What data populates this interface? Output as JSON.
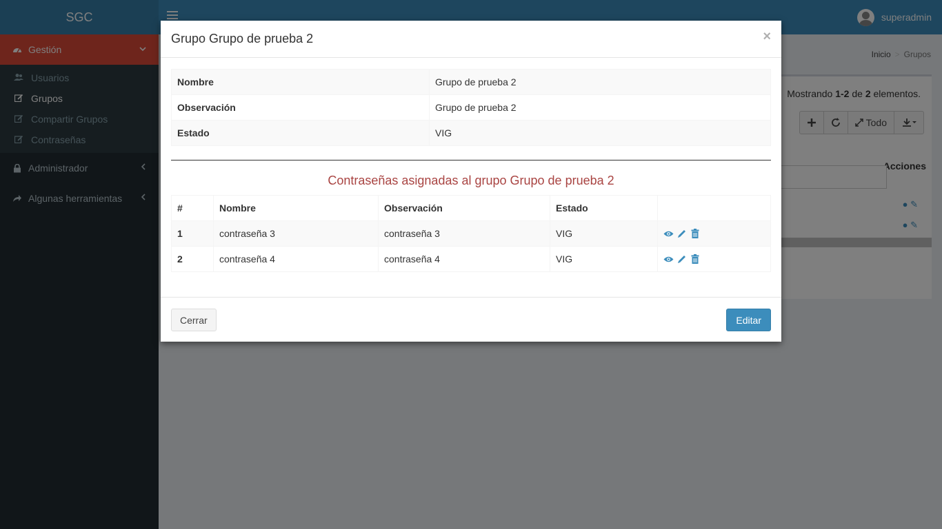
{
  "app": {
    "logo": "SGC",
    "user_name": "superadmin"
  },
  "sidebar": {
    "main": {
      "label": "Gestión"
    },
    "sub_items": [
      {
        "label": "Usuarios"
      },
      {
        "label": "Grupos"
      },
      {
        "label": "Compartir Grupos"
      },
      {
        "label": "Contraseñas"
      }
    ],
    "items": [
      {
        "label": "Administrador"
      },
      {
        "label": "Algunas herramientas"
      }
    ]
  },
  "breadcrumb": {
    "home": "Inicio",
    "current": "Grupos"
  },
  "list": {
    "summary_prefix": "Mostrando",
    "summary_range": "1-2",
    "summary_mid": "de",
    "summary_total": "2",
    "summary_suffix": "elementos.",
    "toolbar_all_label": "Todo",
    "actions_header": "Acciones"
  },
  "modal": {
    "title": "Grupo Grupo de prueba 2",
    "close_symbol": "×",
    "details": [
      {
        "label": "Nombre",
        "value": "Grupo de prueba 2"
      },
      {
        "label": "Observación",
        "value": "Grupo de prueba 2"
      },
      {
        "label": "Estado",
        "value": "VIG"
      }
    ],
    "assigned_title": "Contraseñas asignadas al grupo Grupo de prueba 2",
    "columns": [
      "#",
      "Nombre",
      "Observación",
      "Estado"
    ],
    "rows": [
      {
        "num": "1",
        "nombre": "contraseña 3",
        "observacion": "contraseña 3",
        "estado": "VIG"
      },
      {
        "num": "2",
        "nombre": "contraseña 4",
        "observacion": "contraseña 4",
        "estado": "VIG"
      }
    ],
    "close_button": "Cerrar",
    "edit_button": "Editar"
  },
  "colors": {
    "accent": "#3c8dbc",
    "sidebar_active_bg": "#dd4b39",
    "assigned_title": "#a94442"
  },
  "icons": {
    "gestion": "dashboard-icon",
    "usuarios": "users-icon",
    "edit": "edit-icon",
    "administrador": "lock-icon",
    "herramientas": "share-icon",
    "view": "eye-icon",
    "delete": "trash-icon"
  }
}
